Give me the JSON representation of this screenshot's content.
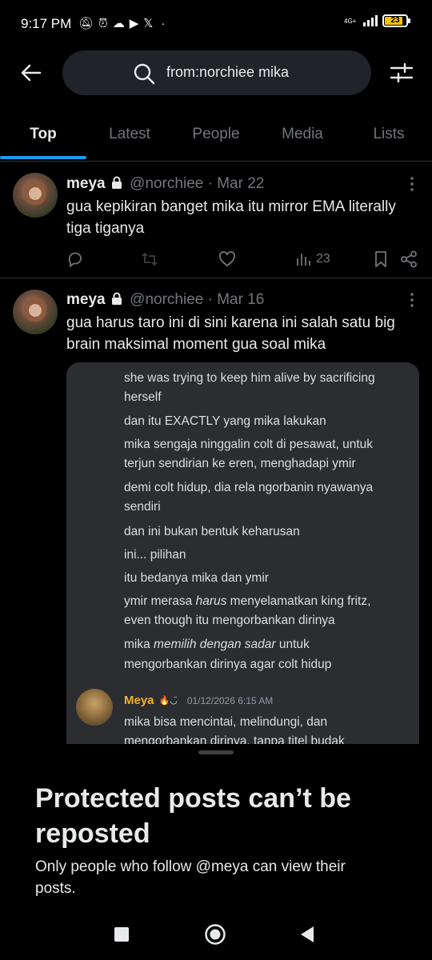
{
  "status_bar": {
    "time": "9:17 PM",
    "network": "4G+",
    "battery": "23"
  },
  "search": {
    "query": "from:norchiee mika"
  },
  "tabs": [
    "Top",
    "Latest",
    "People",
    "Media",
    "Lists"
  ],
  "posts": [
    {
      "display_name": "meya",
      "handle": "@norchiee",
      "separator": "·",
      "date": "Mar 22",
      "text": "gua kepikiran banget mika itu mirror EMA literally tiga tiganya",
      "views": "23"
    },
    {
      "display_name": "meya",
      "handle": "@norchiee",
      "separator": "·",
      "date": "Mar 16",
      "text": "gua harus taro ini di sini karena ini salah satu big brain maksimal moment gua soal mika",
      "media": {
        "lines": [
          "she was trying to keep him alive by sacrificing",
          "herself",
          "dan itu EXACTLY yang mika lakukan",
          "mika sengaja ninggalin colt di pesawat, untuk",
          "terjun sendirian ke eren, menghadapi ymir",
          "demi colt hidup, dia rela ngorbanin nyawanya",
          "sendiri",
          "dan ini bukan bentuk keharusan",
          "ini... pilihan",
          "itu bedanya mika dan ymir",
          "ymir merasa ",
          "harus",
          " menyelamatkan king fritz,",
          "even though itu mengorbankan dirinya",
          "mika ",
          "memilih dengan sadar",
          " untuk",
          "mengorbankan dirinya agar colt hidup"
        ],
        "reply_author": "Meya",
        "reply_emoji": "🔥◡̈",
        "reply_time": "01/12/2026 6:15 AM",
        "reply_line1": "mika bisa mencintai, melindungi, dan",
        "reply_line2": "mengorbankan dirinya, tanpa titel budak"
      }
    }
  ],
  "sheet": {
    "title": "Protected posts can’t be reposted",
    "body": "Only people who follow @meya can view their posts."
  },
  "colors": {
    "accent": "#1d9bf0",
    "background": "#000000",
    "muted": "#71767b",
    "discord_bg": "#2b2d31",
    "discord_name": "#f0b232",
    "battery": "#f5c400"
  },
  "icons": [
    "back-arrow-icon",
    "search-icon",
    "filter-icon",
    "lock-icon",
    "more-icon",
    "reply-icon",
    "repost-icon",
    "like-icon",
    "views-icon",
    "bookmark-icon",
    "share-icon"
  ]
}
